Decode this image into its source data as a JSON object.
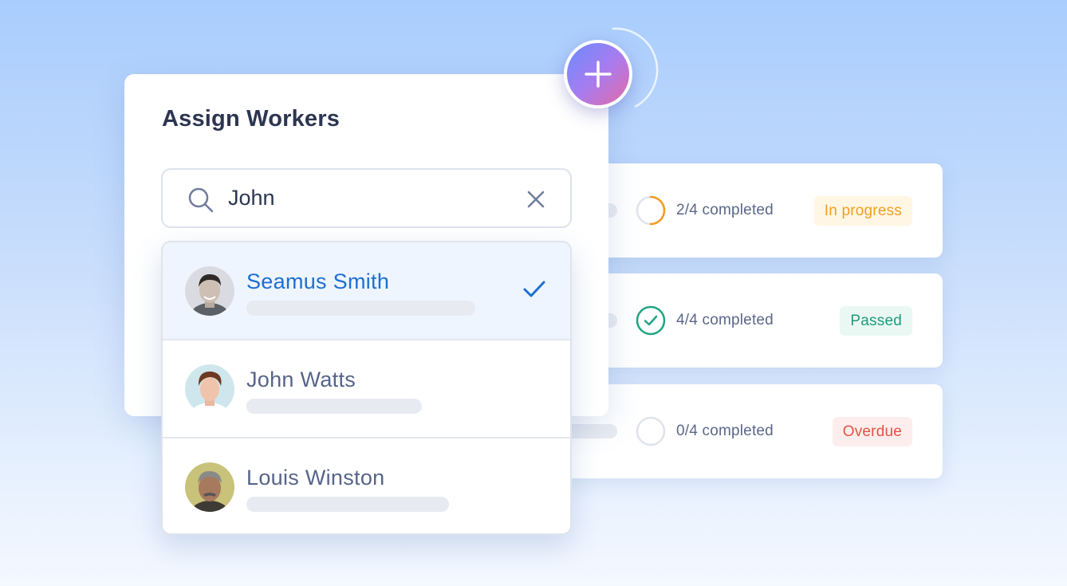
{
  "assign_panel": {
    "title": "Assign Workers",
    "search": {
      "value": "John",
      "placeholder": ""
    }
  },
  "workers": [
    {
      "name": "Seamus Smith",
      "selected": true
    },
    {
      "name": "John Watts",
      "selected": false
    },
    {
      "name": "Louis Winston",
      "selected": false
    }
  ],
  "tasks": [
    {
      "completed_text": "2/4 completed",
      "progress": 0.5,
      "status": "In progress",
      "status_color": "#f0a020"
    },
    {
      "completed_text": "4/4 completed",
      "progress": 1.0,
      "status": "Passed",
      "status_color": "#1f9a7a"
    },
    {
      "completed_text": "0/4 completed",
      "progress": 0.0,
      "status": "Overdue",
      "status_color": "#e45245"
    }
  ],
  "colors": {
    "accent_blue": "#1e6fd0",
    "add_button_gradient": [
      "#6a8dfd",
      "#a67cf0",
      "#e66aa6"
    ]
  },
  "icons": {
    "search": "search-icon",
    "clear": "close-icon",
    "selected": "check-icon",
    "add": "plus-icon"
  }
}
